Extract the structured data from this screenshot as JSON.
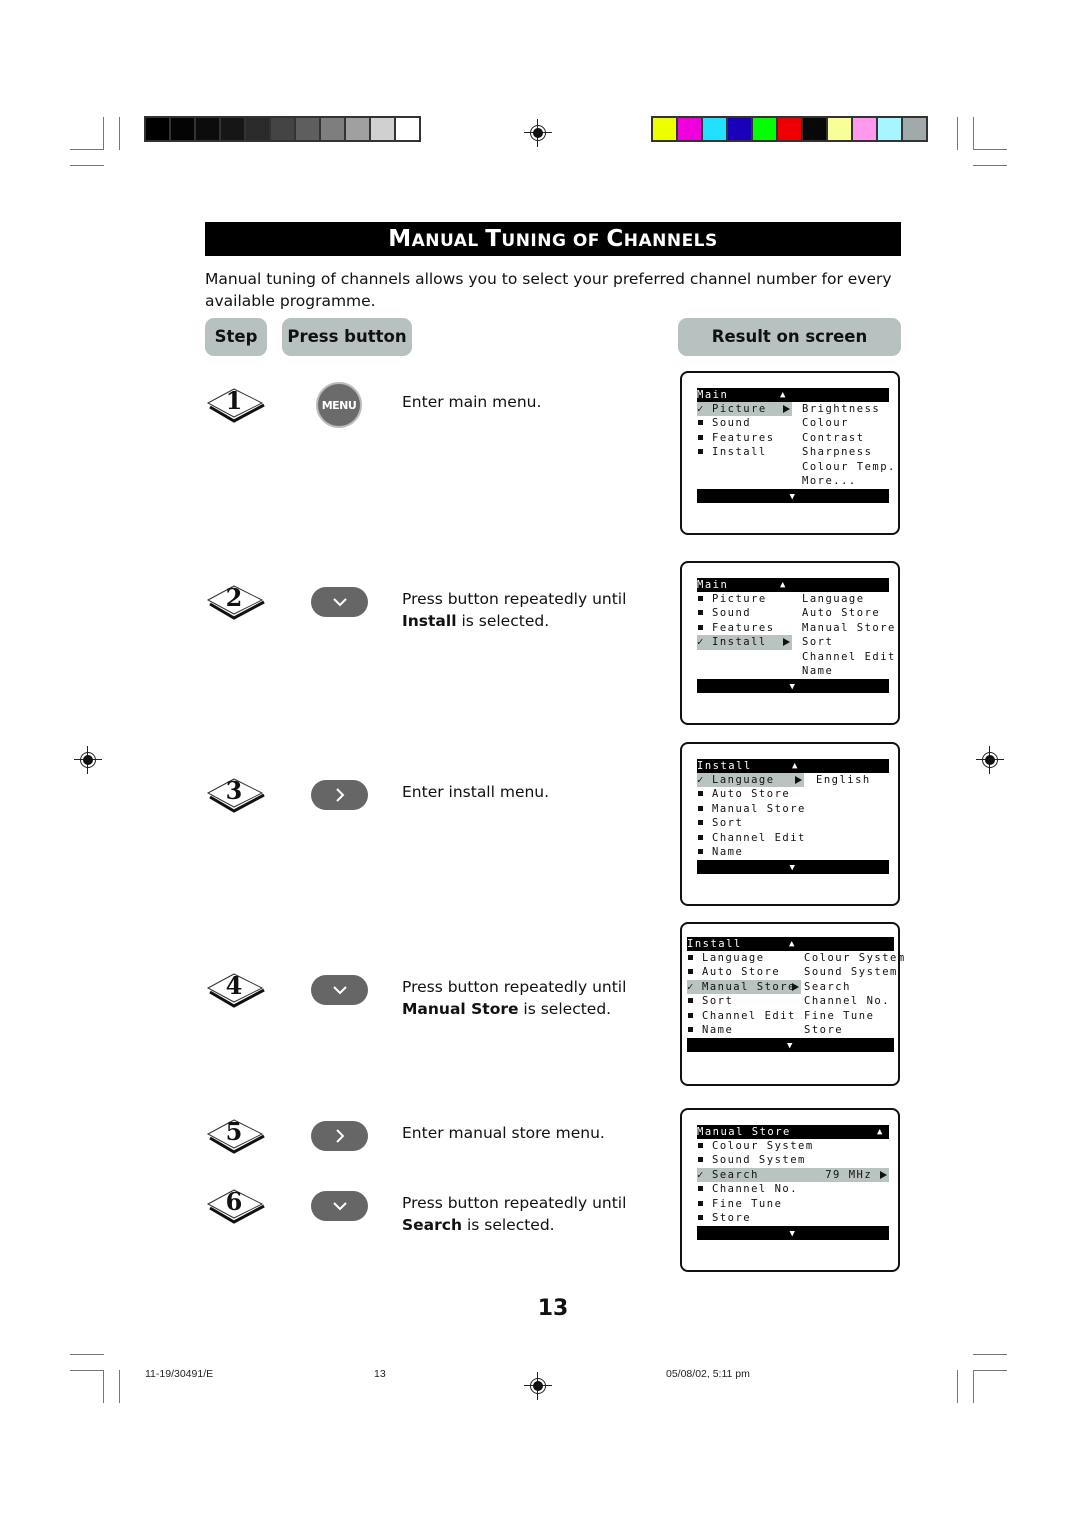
{
  "calibration": {
    "gray_swatches": [
      "#000000",
      "#040404",
      "#0c0c0c",
      "#161616",
      "#2a2a2a",
      "#444444",
      "#5e5e5e",
      "#7e7e7e",
      "#a0a0a0",
      "#d0d0d0",
      "#ffffff"
    ],
    "color_swatches": [
      "#eeff00",
      "#ee00dd",
      "#22e0ff",
      "#1a00bb",
      "#00ff00",
      "#ee0000",
      "#080808",
      "#f8ff99",
      "#ff99ee",
      "#a8f4ff",
      "#a0aaaa"
    ]
  },
  "title": "Manual Tuning of Channels",
  "intro": "Manual tuning of channels allows you to select your preferred channel number for every available programme.",
  "headers": {
    "step": "Step",
    "press_button": "Press button",
    "result": "Result on screen"
  },
  "steps": [
    {
      "num": "1",
      "button": "MENU",
      "button_icon": "menu-button",
      "text": "Enter main menu.",
      "bold": "",
      "after": ""
    },
    {
      "num": "2",
      "button": "down",
      "button_icon": "chevron-down-icon",
      "text": "Press button repeatedly until",
      "bold": "Install",
      "after": " is selected."
    },
    {
      "num": "3",
      "button": "right",
      "button_icon": "chevron-right-icon",
      "text": "Enter install menu.",
      "bold": "",
      "after": ""
    },
    {
      "num": "4",
      "button": "down",
      "button_icon": "chevron-down-icon",
      "text": "Press button repeatedly until",
      "bold": "Manual Store",
      "after": " is selected."
    },
    {
      "num": "5",
      "button": "right",
      "button_icon": "chevron-right-icon",
      "text": "Enter manual store menu.",
      "bold": "",
      "after": ""
    },
    {
      "num": "6",
      "button": "down",
      "button_icon": "chevron-down-icon",
      "text": "Press button repeatedly until",
      "bold": "Search",
      "after": " is selected."
    }
  ],
  "screens": [
    {
      "header": "Main",
      "left": [
        "Picture",
        "Sound",
        "Features",
        "Install"
      ],
      "selected": 0,
      "right": [
        "Brightness",
        "Colour",
        "Contrast",
        "Sharpness",
        "Colour Temp.",
        "More..."
      ]
    },
    {
      "header": "Main",
      "left": [
        "Picture",
        "Sound",
        "Features",
        "Install"
      ],
      "selected": 3,
      "right": [
        "Language",
        "Auto Store",
        "Manual Store",
        "Sort",
        "Channel Edit",
        "Name"
      ]
    },
    {
      "header": "Install",
      "left": [
        "Language",
        "Auto Store",
        "Manual Store",
        "Sort",
        "Channel Edit",
        "Name"
      ],
      "selected": 0,
      "right": [
        "English"
      ]
    },
    {
      "header": "Install",
      "left": [
        "Language",
        "Auto Store",
        "Manual Store",
        "Sort",
        "Channel Edit",
        "Name"
      ],
      "selected": 2,
      "right": [
        "Colour System",
        "Sound System",
        "Search",
        "Channel No.",
        "Fine Tune",
        "Store"
      ]
    },
    {
      "header": "Manual Store",
      "left": [
        "Colour System",
        "Sound System",
        "Search",
        "Channel No.",
        "Fine Tune",
        "Store"
      ],
      "selected": 2,
      "value": "79 MHz",
      "right": []
    }
  ],
  "osd_symbols": {
    "up": "▲",
    "down": "▼",
    "check": "✓"
  },
  "page_number": "13",
  "footer": {
    "doc_code": "11-19/30491/E",
    "page": "13",
    "date": "05/08/02, 5:11 pm"
  }
}
